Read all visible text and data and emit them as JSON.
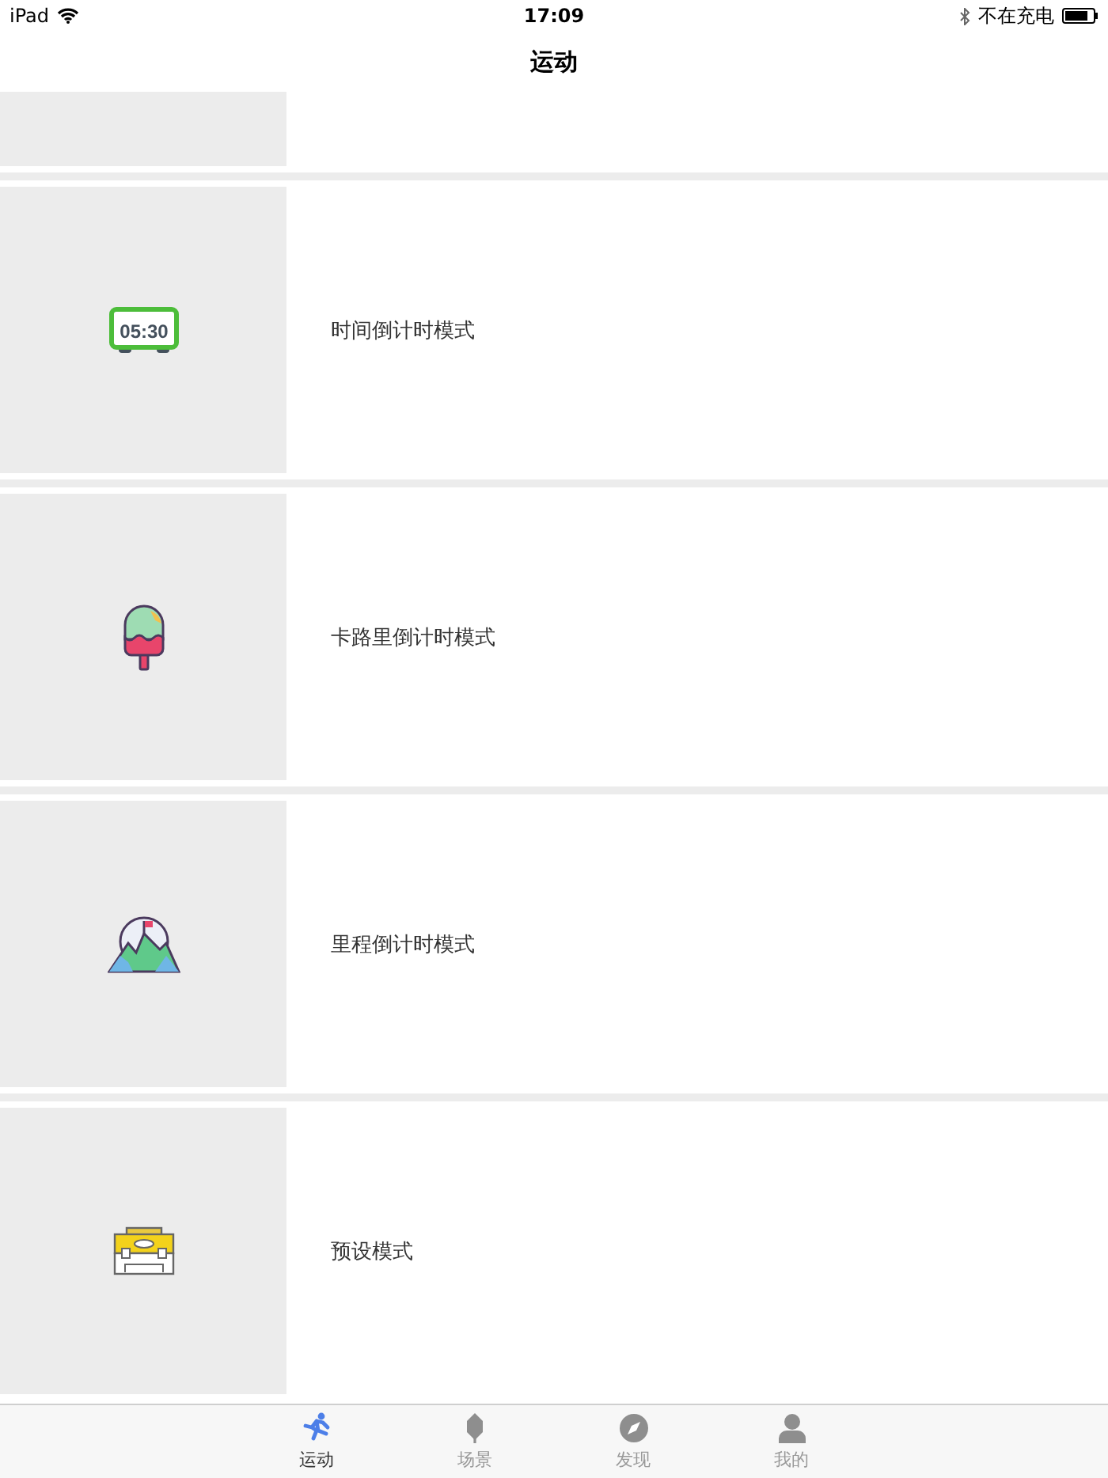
{
  "status_bar": {
    "device": "iPad",
    "time": "17:09",
    "charging": "不在充电"
  },
  "nav_bar": {
    "title": "运动"
  },
  "modes": [
    {
      "kind": "clock",
      "label": "时间倒计时模式",
      "icon_text": "05:30"
    },
    {
      "kind": "popsicle",
      "label": "卡路里倒计时模式"
    },
    {
      "kind": "mountain",
      "label": "里程倒计时模式"
    },
    {
      "kind": "toolbox",
      "label": "预设模式"
    }
  ],
  "tab_bar": [
    {
      "kind": "run",
      "label": "运动",
      "selected": true
    },
    {
      "kind": "leaf",
      "label": "场景",
      "selected": false
    },
    {
      "kind": "compass",
      "label": "发现",
      "selected": false
    },
    {
      "kind": "person",
      "label": "我的",
      "selected": false
    }
  ]
}
